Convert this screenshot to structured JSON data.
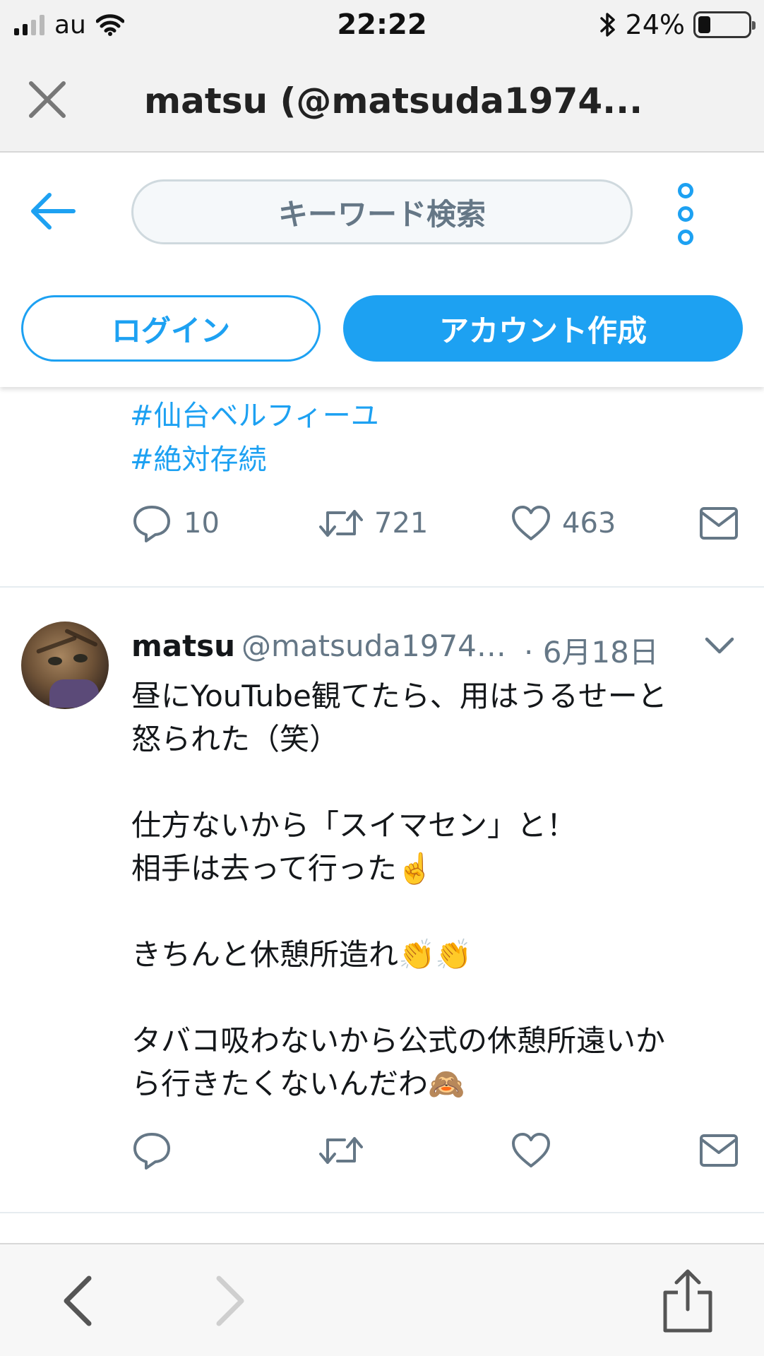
{
  "status_bar": {
    "carrier": "au",
    "time": "22:22",
    "battery_percent": "24%",
    "battery_level": 0.24,
    "signal_bars": 2
  },
  "browser": {
    "title": "matsu (@matsuda1974...",
    "close_icon": "close-icon",
    "back_icon": "chevron-left-icon",
    "forward_icon": "chevron-right-icon",
    "share_icon": "share-icon"
  },
  "twitter_header": {
    "search_placeholder": "キーワード検索",
    "login_label": "ログイン",
    "signup_label": "アカウント作成",
    "accent_color": "#1da1f2"
  },
  "previous_tweet": {
    "hashtags": [
      "#仙台ベルフィーユ",
      "#絶対存続"
    ],
    "replies": "10",
    "retweets": "721",
    "likes": "463"
  },
  "tweet": {
    "name": "matsu",
    "handle": "@matsuda1974…",
    "date": "· 6月18日",
    "lines": [
      "昼にYouTube観てたら、用はうるせーと",
      "怒られた（笑）",
      "",
      "仕方ないから「スイマセン」と！",
      "相手は去って行った☝️",
      "",
      "きちんと休憩所造れ👏👏",
      "",
      "タバコ吸わないから公式の休憩所遠いか",
      "ら行きたくないんだわ🙈"
    ]
  }
}
